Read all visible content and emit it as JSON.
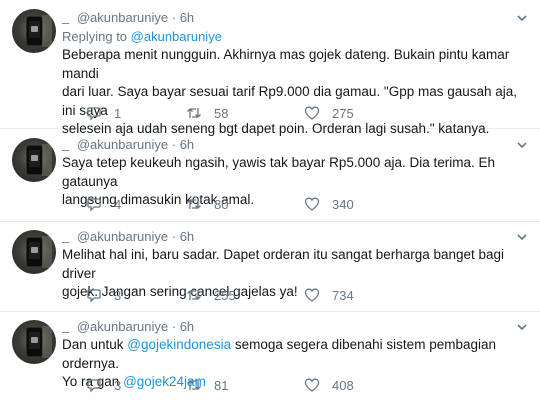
{
  "tweets": [
    {
      "display_name": "_",
      "handle": "@akunbaruniye",
      "time": "6h",
      "replying_label": "Replying to",
      "replying_handle": "@akunbaruniye",
      "text_lines": [
        "Beberapa menit nungguin. Akhirnya mas gojek dateng. Bukain pintu kamar mandi",
        "dari luar. Saya bayar sesuai tarif Rp9.000 dia gamau. \"Gpp mas gausah aja, ini saya",
        "selesein aja udah seneng bgt dapet poin. Orderan lagi susah.\" katanya."
      ],
      "replies": "1",
      "retweets": "58",
      "likes": "275"
    },
    {
      "display_name": "_",
      "handle": "@akunbaruniye",
      "time": "6h",
      "text_lines": [
        "Saya tetep keukeuh ngasih, yawis tak bayar Rp5.000 aja. Dia terima. Eh gataunya",
        "langsung dimasukin kotak amal."
      ],
      "replies": "4",
      "retweets": "80",
      "likes": "340"
    },
    {
      "display_name": "_",
      "handle": "@akunbaruniye",
      "time": "6h",
      "text_lines": [
        "Melihat hal ini, baru sadar. Dapet orderan itu sangat berharga banget bagi driver",
        "gojek. Jangan sering cancel gajelas ya!"
      ],
      "replies": "3",
      "retweets": "255",
      "likes": "734"
    },
    {
      "display_name": "_",
      "handle": "@akunbaruniye",
      "time": "6h",
      "line1": {
        "pre": "Dan untuk ",
        "mention": "@gojekindonesia",
        "post": " semoga segera dibenahi sistem pembagian ordernya."
      },
      "line2": {
        "pre": "Yo ra gan ",
        "mention": "@gojek24jam"
      },
      "replies": "3",
      "retweets": "81",
      "likes": "408"
    }
  ],
  "icons": [
    "avatar",
    "chevron-down-icon",
    "reply-icon",
    "retweet-icon",
    "like-icon"
  ],
  "colors": {
    "text": "#14171a",
    "secondary": "#657786",
    "link": "#1b95e0",
    "divider": "#e6ecf0"
  }
}
